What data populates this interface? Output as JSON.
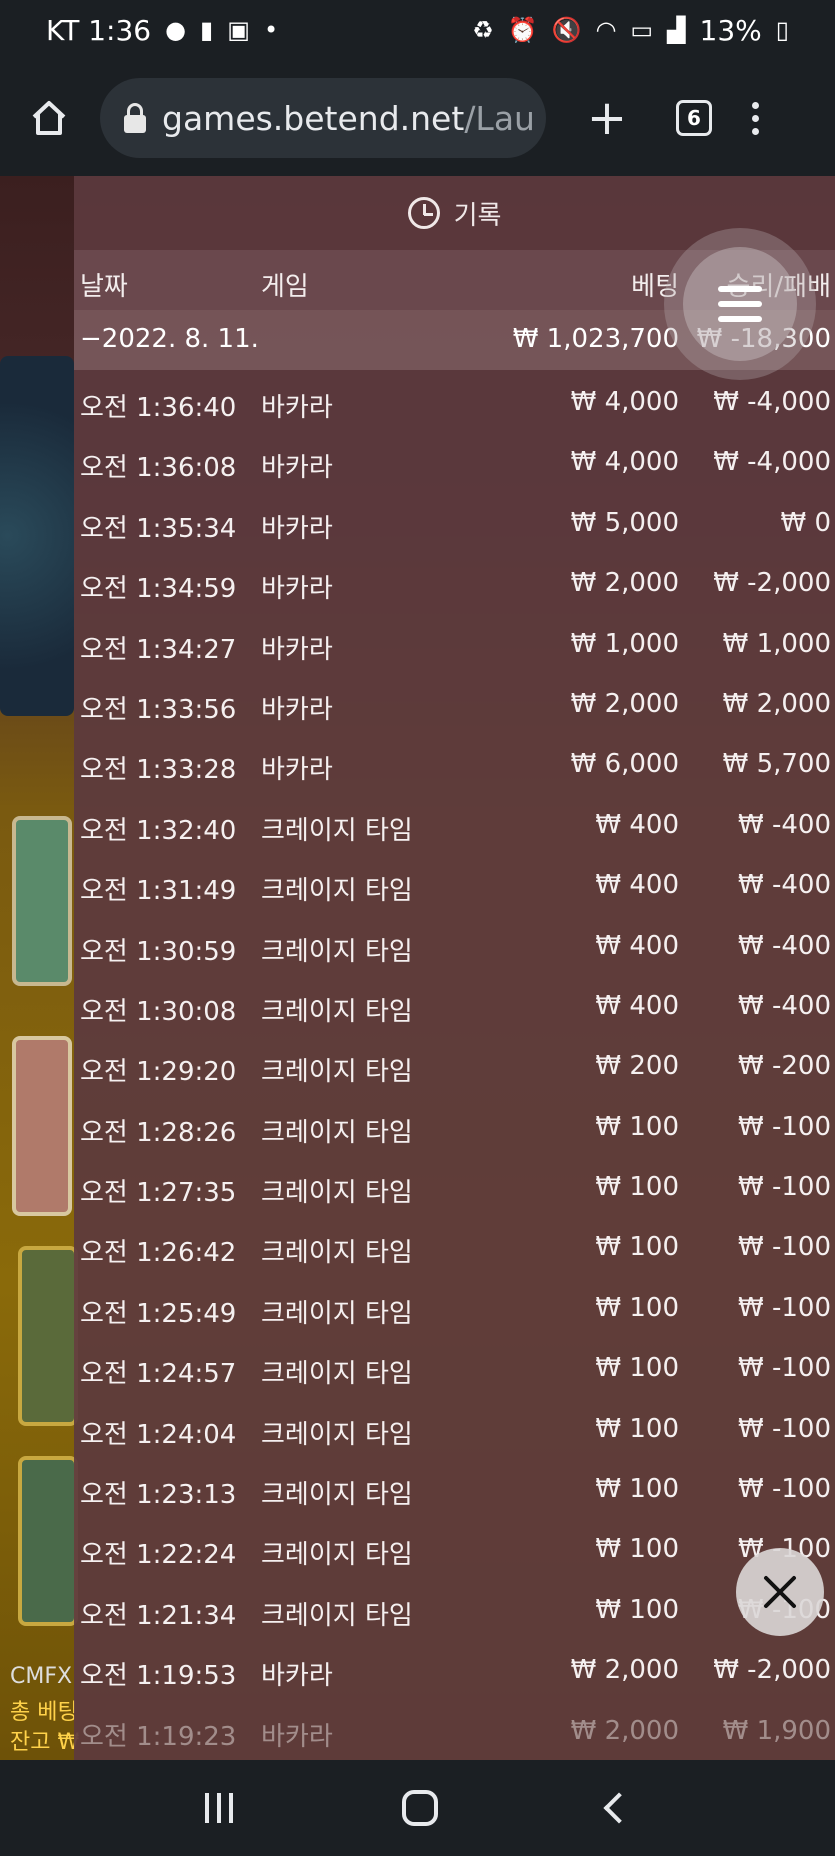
{
  "status_bar": {
    "carrier_time": "KT 1:36",
    "battery": "13%",
    "left_icons": [
      "chat-icon",
      "alert-icon",
      "image-icon",
      "dot-icon"
    ],
    "right_icons": [
      "recycle-icon",
      "alarm-icon",
      "mute-icon",
      "wifi-icon",
      "hd-icon",
      "signal-icon",
      "battery-icon"
    ]
  },
  "browser": {
    "url_domain": "games.betend.net",
    "url_path": "/Lau",
    "tab_count": "6"
  },
  "background": {
    "left_labels": [
      "CMFX",
      "총 베팅",
      "잔고 ₩"
    ]
  },
  "panel": {
    "title": "기록",
    "columns": {
      "date": "날짜",
      "game": "게임",
      "bet": "베팅",
      "result": "승리/패배"
    },
    "date_group": {
      "label": "−2022. 8. 11.",
      "bet": "₩ 1,023,700",
      "result": "₩ -18,300"
    },
    "rows": [
      {
        "time": "오전 1:36:40",
        "game": "바카라",
        "bet": "₩ 4,000",
        "result": "₩ -4,000"
      },
      {
        "time": "오전 1:36:08",
        "game": "바카라",
        "bet": "₩ 4,000",
        "result": "₩ -4,000"
      },
      {
        "time": "오전 1:35:34",
        "game": "바카라",
        "bet": "₩ 5,000",
        "result": "₩ 0"
      },
      {
        "time": "오전 1:34:59",
        "game": "바카라",
        "bet": "₩ 2,000",
        "result": "₩ -2,000"
      },
      {
        "time": "오전 1:34:27",
        "game": "바카라",
        "bet": "₩ 1,000",
        "result": "₩ 1,000"
      },
      {
        "time": "오전 1:33:56",
        "game": "바카라",
        "bet": "₩ 2,000",
        "result": "₩ 2,000"
      },
      {
        "time": "오전 1:33:28",
        "game": "바카라",
        "bet": "₩ 6,000",
        "result": "₩ 5,700"
      },
      {
        "time": "오전 1:32:40",
        "game": "크레이지 타임",
        "bet": "₩ 400",
        "result": "₩ -400"
      },
      {
        "time": "오전 1:31:49",
        "game": "크레이지 타임",
        "bet": "₩ 400",
        "result": "₩ -400"
      },
      {
        "time": "오전 1:30:59",
        "game": "크레이지 타임",
        "bet": "₩ 400",
        "result": "₩ -400"
      },
      {
        "time": "오전 1:30:08",
        "game": "크레이지 타임",
        "bet": "₩ 400",
        "result": "₩ -400"
      },
      {
        "time": "오전 1:29:20",
        "game": "크레이지 타임",
        "bet": "₩ 200",
        "result": "₩ -200"
      },
      {
        "time": "오전 1:28:26",
        "game": "크레이지 타임",
        "bet": "₩ 100",
        "result": "₩ -100"
      },
      {
        "time": "오전 1:27:35",
        "game": "크레이지 타임",
        "bet": "₩ 100",
        "result": "₩ -100"
      },
      {
        "time": "오전 1:26:42",
        "game": "크레이지 타임",
        "bet": "₩ 100",
        "result": "₩ -100"
      },
      {
        "time": "오전 1:25:49",
        "game": "크레이지 타임",
        "bet": "₩ 100",
        "result": "₩ -100"
      },
      {
        "time": "오전 1:24:57",
        "game": "크레이지 타임",
        "bet": "₩ 100",
        "result": "₩ -100"
      },
      {
        "time": "오전 1:24:04",
        "game": "크레이지 타임",
        "bet": "₩ 100",
        "result": "₩ -100"
      },
      {
        "time": "오전 1:23:13",
        "game": "크레이지 타임",
        "bet": "₩ 100",
        "result": "₩ -100"
      },
      {
        "time": "오전 1:22:24",
        "game": "크레이지 타임",
        "bet": "₩ 100",
        "result": "₩ -100"
      },
      {
        "time": "오전 1:21:34",
        "game": "크레이지 타임",
        "bet": "₩ 100",
        "result": "₩ -100"
      },
      {
        "time": "오전 1:19:53",
        "game": "바카라",
        "bet": "₩ 2,000",
        "result": "₩ -2,000"
      },
      {
        "time": "오전 1:19:23",
        "game": "바카라",
        "bet": "₩ 2,000",
        "result": "₩ 1,900"
      }
    ]
  },
  "icons": {
    "menu": "hamburger-menu-icon",
    "close": "close-icon",
    "history": "history-clock-icon"
  }
}
